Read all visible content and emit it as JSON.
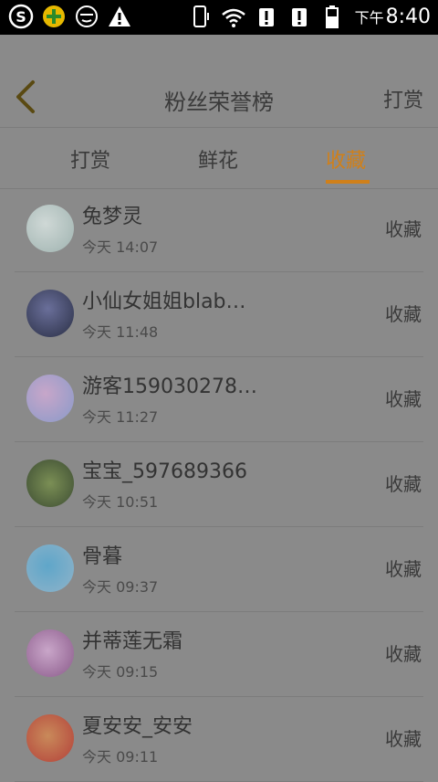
{
  "status_bar": {
    "time_prefix": "下午",
    "time": "8:40"
  },
  "header": {
    "title": "粉丝荣誉榜",
    "right_action": "打赏"
  },
  "tabs": [
    {
      "label": "打赏",
      "active": false
    },
    {
      "label": "鲜花",
      "active": false
    },
    {
      "label": "收藏",
      "active": true
    }
  ],
  "colors": {
    "accent": "#d0801a",
    "background": "#8a8a8a"
  },
  "list": [
    {
      "name": "兔梦灵",
      "time": "今天 14:07",
      "action": "收藏",
      "avatar_colors": [
        "#cfd8d6",
        "#9fb3b0"
      ]
    },
    {
      "name": "小仙女姐姐blab…",
      "time": "今天 11:48",
      "action": "收藏",
      "avatar_colors": [
        "#2a2f45",
        "#6a6f9a"
      ]
    },
    {
      "name": "游客159030278…",
      "time": "今天 11:27",
      "action": "收藏",
      "avatar_colors": [
        "#c7a6c9",
        "#8a9ac9"
      ]
    },
    {
      "name": "宝宝_597689366",
      "time": "今天 10:51",
      "action": "收藏",
      "avatar_colors": [
        "#3d4d33",
        "#7b8f55"
      ]
    },
    {
      "name": "骨暮",
      "time": "今天 09:37",
      "action": "收藏",
      "avatar_colors": [
        "#8fb3c9",
        "#5fa6c9"
      ]
    },
    {
      "name": "并蒂莲无霜",
      "time": "今天 09:15",
      "action": "收藏",
      "avatar_colors": [
        "#c9a6c9",
        "#8a5a8a"
      ]
    },
    {
      "name": "夏安安_安安",
      "time": "今天 09:11",
      "action": "收藏",
      "avatar_colors": [
        "#c98a5a",
        "#b3403a"
      ]
    }
  ]
}
